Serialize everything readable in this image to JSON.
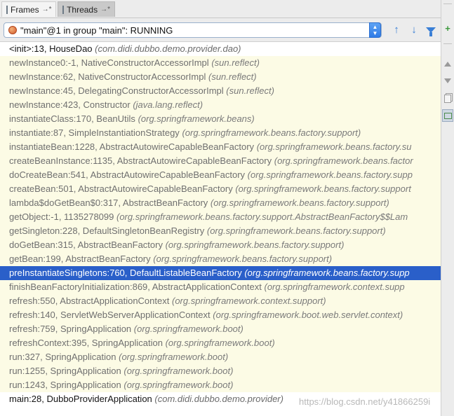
{
  "tabs": [
    {
      "label": "Frames",
      "pin": "→*"
    },
    {
      "label": "Threads",
      "pin": "→*"
    }
  ],
  "thread_selector": {
    "value": "\"main\"@1 in group \"main\": RUNNING"
  },
  "frames": [
    {
      "method": "<init>:13, HouseDao",
      "package": "(com.didi.dubbo.demo.provider.dao)",
      "style": "normal"
    },
    {
      "method": "newInstance0:-1, NativeConstructorAccessorImpl",
      "package": "(sun.reflect)",
      "style": "lib"
    },
    {
      "method": "newInstance:62, NativeConstructorAccessorImpl",
      "package": "(sun.reflect)",
      "style": "lib"
    },
    {
      "method": "newInstance:45, DelegatingConstructorAccessorImpl",
      "package": "(sun.reflect)",
      "style": "lib"
    },
    {
      "method": "newInstance:423, Constructor",
      "package": "(java.lang.reflect)",
      "style": "lib"
    },
    {
      "method": "instantiateClass:170, BeanUtils",
      "package": "(org.springframework.beans)",
      "style": "lib"
    },
    {
      "method": "instantiate:87, SimpleInstantiationStrategy",
      "package": "(org.springframework.beans.factory.support)",
      "style": "lib"
    },
    {
      "method": "instantiateBean:1228, AbstractAutowireCapableBeanFactory",
      "package": "(org.springframework.beans.factory.su",
      "style": "lib"
    },
    {
      "method": "createBeanInstance:1135, AbstractAutowireCapableBeanFactory",
      "package": "(org.springframework.beans.factor",
      "style": "lib"
    },
    {
      "method": "doCreateBean:541, AbstractAutowireCapableBeanFactory",
      "package": "(org.springframework.beans.factory.supp",
      "style": "lib"
    },
    {
      "method": "createBean:501, AbstractAutowireCapableBeanFactory",
      "package": "(org.springframework.beans.factory.support",
      "style": "lib"
    },
    {
      "method": "lambda$doGetBean$0:317, AbstractBeanFactory",
      "package": "(org.springframework.beans.factory.support)",
      "style": "lib"
    },
    {
      "method": "getObject:-1, 1135278099",
      "package": "(org.springframework.beans.factory.support.AbstractBeanFactory$$Lam",
      "style": "lib"
    },
    {
      "method": "getSingleton:228, DefaultSingletonBeanRegistry",
      "package": "(org.springframework.beans.factory.support)",
      "style": "lib"
    },
    {
      "method": "doGetBean:315, AbstractBeanFactory",
      "package": "(org.springframework.beans.factory.support)",
      "style": "lib"
    },
    {
      "method": "getBean:199, AbstractBeanFactory",
      "package": "(org.springframework.beans.factory.support)",
      "style": "lib"
    },
    {
      "method": "preInstantiateSingletons:760, DefaultListableBeanFactory",
      "package": "(org.springframework.beans.factory.supp",
      "style": "selected"
    },
    {
      "method": "finishBeanFactoryInitialization:869, AbstractApplicationContext",
      "package": "(org.springframework.context.supp",
      "style": "lib"
    },
    {
      "method": "refresh:550, AbstractApplicationContext",
      "package": "(org.springframework.context.support)",
      "style": "lib"
    },
    {
      "method": "refresh:140, ServletWebServerApplicationContext",
      "package": "(org.springframework.boot.web.servlet.context)",
      "style": "lib"
    },
    {
      "method": "refresh:759, SpringApplication",
      "package": "(org.springframework.boot)",
      "style": "lib"
    },
    {
      "method": "refreshContext:395, SpringApplication",
      "package": "(org.springframework.boot)",
      "style": "lib"
    },
    {
      "method": "run:327, SpringApplication",
      "package": "(org.springframework.boot)",
      "style": "lib"
    },
    {
      "method": "run:1255, SpringApplication",
      "package": "(org.springframework.boot)",
      "style": "lib"
    },
    {
      "method": "run:1243, SpringApplication",
      "package": "(org.springframework.boot)",
      "style": "lib"
    },
    {
      "method": "main:28, DubboProviderApplication",
      "package": "(com.didi.dubbo.demo.provider)",
      "style": "normal"
    }
  ],
  "watermark": "https://blog.csdn.net/y41866259i",
  "colors": {
    "selected_row": "#2a5fc9",
    "library_row": "#fcfbe5",
    "accent": "#3a7fd6"
  },
  "icons": {
    "frames_tab": "frames-icon",
    "threads_tab": "threads-icon",
    "thread_status": "thread-running-icon",
    "up": "arrow-up-icon",
    "down": "arrow-down-icon",
    "filter": "filter-icon"
  }
}
